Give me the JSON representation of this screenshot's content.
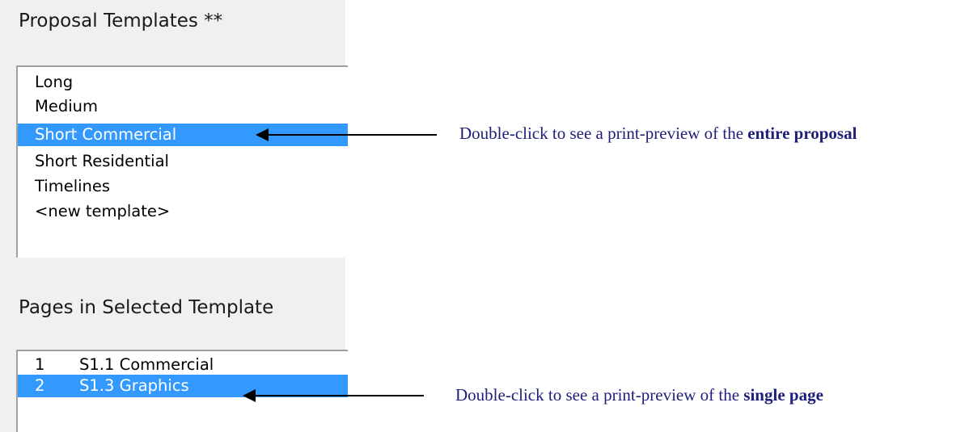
{
  "templates": {
    "heading": "Proposal Templates **",
    "items": [
      "Long",
      "Medium",
      "Short Commercial",
      "Short Residential",
      "Timelines",
      "<new template>"
    ],
    "selected_index": 2
  },
  "pages": {
    "heading": "Pages in Selected Template",
    "items": [
      {
        "num": "1",
        "label": "S1.1 Commercial"
      },
      {
        "num": "2",
        "label": "S1.3 Graphics"
      }
    ],
    "selected_index": 1
  },
  "annotations": {
    "template_note_prefix": "Double-click to see a print-preview of the ",
    "template_note_bold": "entire proposal",
    "page_note_prefix": "Double-click to see a print-preview of the ",
    "page_note_bold": "single page"
  },
  "colors": {
    "selection": "#3399ff",
    "annotation_text": "#1f1f7a"
  }
}
